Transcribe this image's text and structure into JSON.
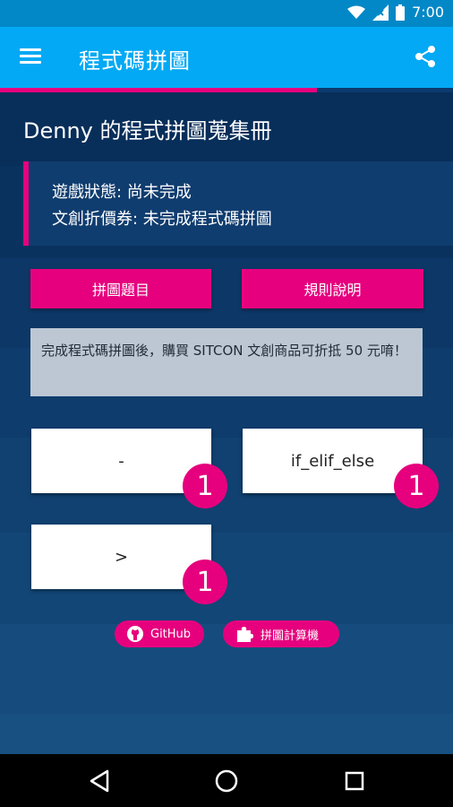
{
  "status_bar": {
    "time": "7:00"
  },
  "app_bar": {
    "title": "程式碼拼圖"
  },
  "progress": {
    "fraction": 0.7
  },
  "page": {
    "heading": "Denny 的程式拼圖蒐集冊",
    "status_lines": {
      "game_status": "遊戲狀態: 尚未完成",
      "coupon_status": "文創折價券: 未完成程式碼拼圖"
    },
    "buttons": {
      "puzzle_topics": "拼圖題目",
      "rules": "規則說明"
    },
    "note": "完成程式碼拼圖後，購買 SITCON 文創商品可折抵 50 元唷！",
    "cards": [
      {
        "label": "-",
        "count": "1"
      },
      {
        "label": "if_elif_else",
        "count": "1"
      },
      {
        "label": ">",
        "count": "1"
      }
    ],
    "links": {
      "github": "GitHub",
      "calculator": "拼圖計算機"
    }
  },
  "colors": {
    "accent": "#e6007e",
    "appbar": "#03a9f4",
    "statusbar": "#0288c7",
    "background": "#0d3a6a"
  },
  "icons": [
    "wifi-icon",
    "signal-icon",
    "battery-icon",
    "menu-icon",
    "share-icon",
    "github-icon",
    "puzzle-icon",
    "back-icon",
    "home-icon",
    "recents-icon"
  ]
}
